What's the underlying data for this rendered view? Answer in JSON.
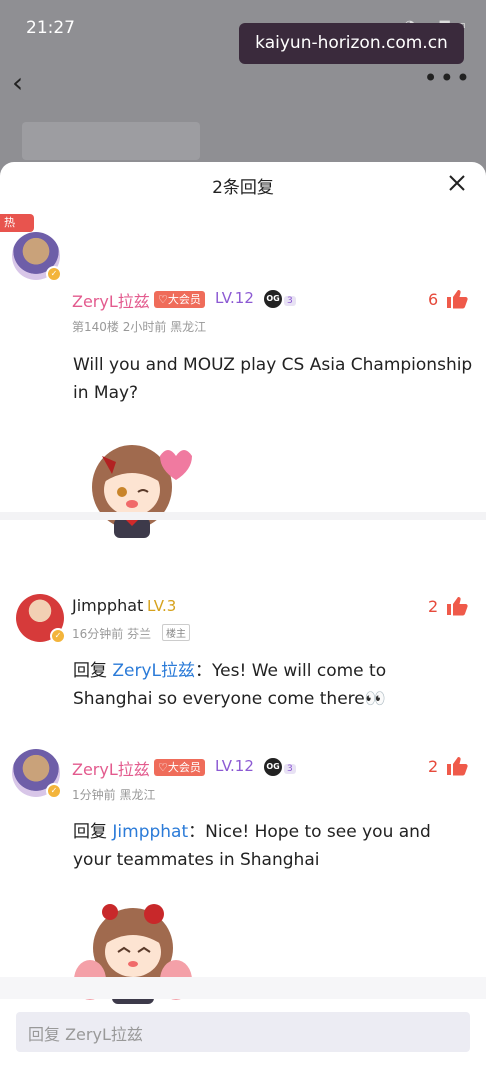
{
  "status": {
    "time": "21:27"
  },
  "watermark": "kaiyun-horizon.com.cn",
  "sheet": {
    "title": "2条回复"
  },
  "comments": [
    {
      "hot_tag": "热",
      "username": "ZeryL拉兹",
      "vip": "♡大会员",
      "level": "LV.12",
      "og": "OG",
      "og_num": "3",
      "meta": "第140楼 2小时前 黑龙江",
      "likes": "6",
      "text": "Will you and MOUZ play CS Asia Championship in May?"
    },
    {
      "username": "Jimpphat",
      "level": "LV.3",
      "meta": "16分钟前 芬兰",
      "owner_tag": "楼主",
      "likes": "2",
      "reply_prefix": "回复 ",
      "mention": "ZeryL拉兹",
      "text": "：Yes! We will come to Shanghai so everyone come there👀"
    },
    {
      "username": "ZeryL拉兹",
      "vip": "♡大会员",
      "level": "LV.12",
      "og": "OG",
      "og_num": "3",
      "meta": "1分钟前 黑龙江",
      "likes": "2",
      "reply_prefix": "回复 ",
      "mention": "Jimpphat",
      "text": "：Nice! Hope to see you and your teammates in Shanghai"
    }
  ],
  "input": {
    "placeholder": "回复 ZeryL拉兹"
  },
  "colors": {
    "accent_pink": "#e35b8e",
    "like_red": "#e64a3b",
    "mention_blue": "#2b7bd8"
  }
}
